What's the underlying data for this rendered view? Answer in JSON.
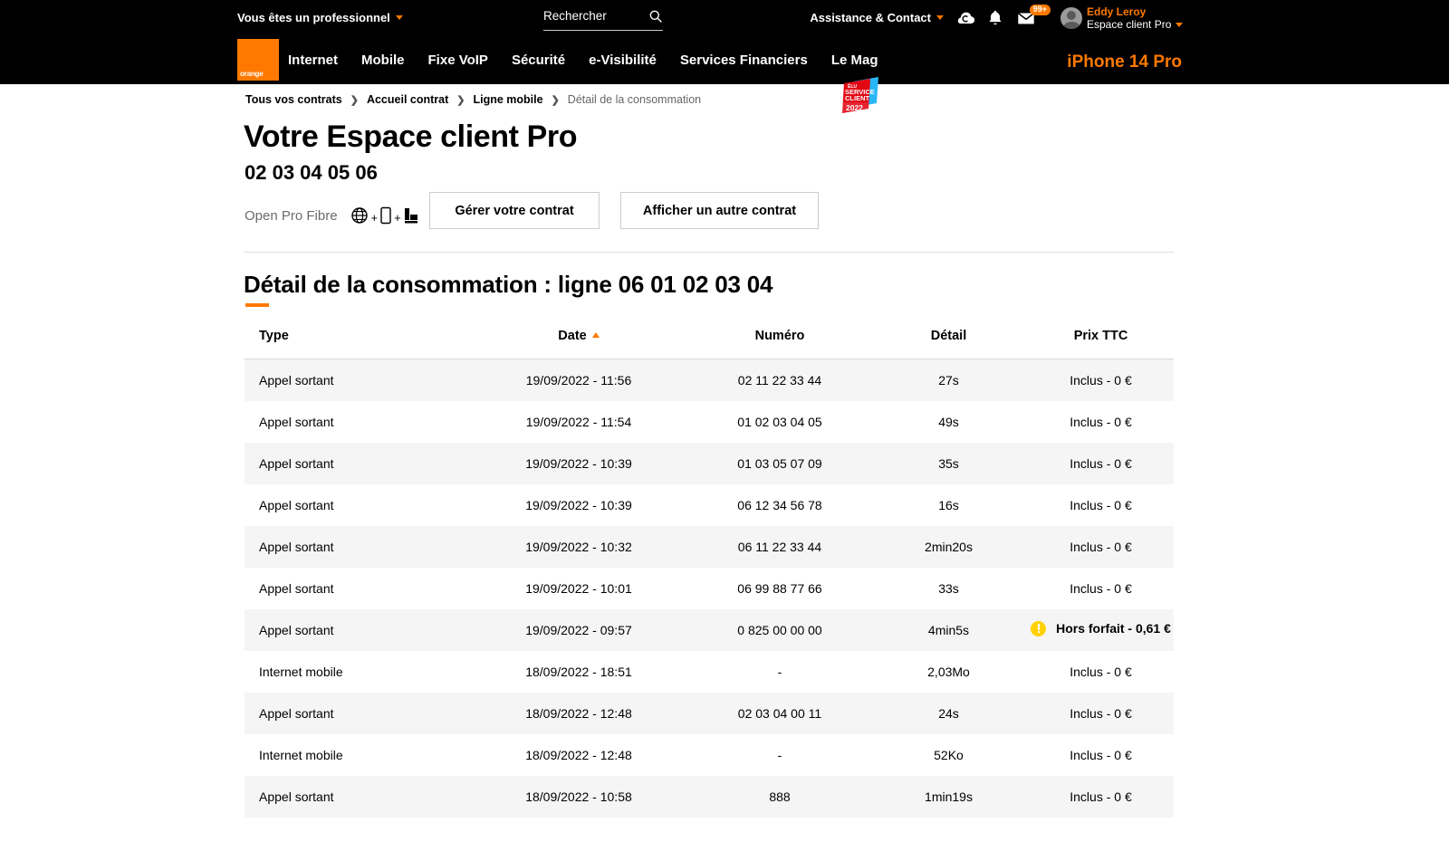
{
  "header": {
    "pro_switch_label": "Vous êtes un professionnel",
    "search": {
      "placeholder": "Rechercher",
      "value": ""
    },
    "assistance_label": "Assistance & Contact",
    "mail_badge": "99+",
    "user": {
      "name": "Eddy Leroy",
      "space": "Espace client Pro"
    },
    "logo_text": "orange",
    "nav_items": [
      {
        "label": "Internet"
      },
      {
        "label": "Mobile"
      },
      {
        "label": "Fixe VoIP"
      },
      {
        "label": "Sécurité"
      },
      {
        "label": "e-Visibilité"
      },
      {
        "label": "Services Financiers"
      },
      {
        "label": "Le Mag"
      }
    ],
    "service_badge": {
      "line1": "ÉLU",
      "line2": "SERVICE",
      "line3": "CLIENT",
      "year": "2022"
    },
    "promo_label": "iPhone 14 Pro"
  },
  "breadcrumb": {
    "items": [
      {
        "label": "Tous vos contrats",
        "current": false
      },
      {
        "label": "Accueil contrat",
        "current": false
      },
      {
        "label": "Ligne mobile",
        "current": false
      },
      {
        "label": "Détail de la consommation",
        "current": true
      }
    ],
    "separator": "❯"
  },
  "page": {
    "title": "Votre Espace client Pro",
    "line_number": "02 03 04 05 06",
    "offer_name": "Open Pro Fibre",
    "offer_icons": "globe-icon + mobile-icon + landline-icon",
    "btn_manage": "Gérer votre contrat",
    "btn_other_contract": "Afficher un autre contrat",
    "section_title": "Détail de la consommation : ligne 06 01 02 03 04",
    "accent_color": "#ff7900"
  },
  "table": {
    "columns": [
      {
        "key": "type",
        "label": "Type"
      },
      {
        "key": "date",
        "label": "Date",
        "sorted": "asc"
      },
      {
        "key": "numero",
        "label": "Numéro"
      },
      {
        "key": "detail",
        "label": "Détail"
      },
      {
        "key": "prix",
        "label": "Prix TTC"
      }
    ],
    "rows": [
      {
        "type": "Appel sortant",
        "date": "19/09/2022 - 11:56",
        "numero": "02 11 22 33 44",
        "detail": "27s",
        "prix": "Inclus - 0 €",
        "warn": false
      },
      {
        "type": "Appel sortant",
        "date": "19/09/2022 - 11:54",
        "numero": "01 02 03 04 05",
        "detail": "49s",
        "prix": "Inclus - 0 €",
        "warn": false
      },
      {
        "type": "Appel sortant",
        "date": "19/09/2022 - 10:39",
        "numero": "01 03 05 07 09",
        "detail": "35s",
        "prix": "Inclus - 0 €",
        "warn": false
      },
      {
        "type": "Appel sortant",
        "date": "19/09/2022 - 10:39",
        "numero": "06 12 34 56 78",
        "detail": "16s",
        "prix": "Inclus - 0 €",
        "warn": false
      },
      {
        "type": "Appel sortant",
        "date": "19/09/2022 - 10:32",
        "numero": "06 11 22 33 44",
        "detail": "2min20s",
        "prix": "Inclus - 0 €",
        "warn": false
      },
      {
        "type": "Appel sortant",
        "date": "19/09/2022 - 10:01",
        "numero": "06 99 88 77 66",
        "detail": "33s",
        "prix": "Inclus - 0 €",
        "warn": false
      },
      {
        "type": "Appel sortant",
        "date": "19/09/2022 - 09:57",
        "numero": "0 825 00 00 00",
        "detail": "4min5s",
        "prix": "Hors forfait - 0,61 €",
        "warn": true
      },
      {
        "type": "Internet mobile",
        "date": "18/09/2022 - 18:51",
        "numero": "-",
        "detail": "2,03Mo",
        "prix": "Inclus - 0 €",
        "warn": false
      },
      {
        "type": "Appel sortant",
        "date": "18/09/2022 - 12:48",
        "numero": "02 03 04 00 11",
        "detail": "24s",
        "prix": "Inclus - 0 €",
        "warn": false
      },
      {
        "type": "Internet mobile",
        "date": "18/09/2022 - 12:48",
        "numero": "-",
        "detail": "52Ko",
        "prix": "Inclus - 0 €",
        "warn": false
      },
      {
        "type": "Appel sortant",
        "date": "18/09/2022 - 10:58",
        "numero": "888",
        "detail": "1min19s",
        "prix": "Inclus - 0 €",
        "warn": false
      }
    ]
  }
}
